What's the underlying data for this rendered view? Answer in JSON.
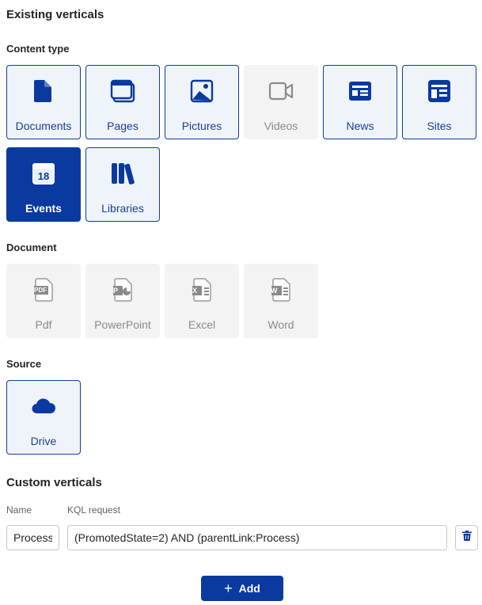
{
  "existing": {
    "title": "Existing verticals",
    "content_type": {
      "heading": "Content type",
      "tiles": [
        {
          "label": "Documents",
          "icon": "document-icon",
          "state": "active"
        },
        {
          "label": "Pages",
          "icon": "pages-icon",
          "state": "active"
        },
        {
          "label": "Pictures",
          "icon": "picture-icon",
          "state": "active"
        },
        {
          "label": "Videos",
          "icon": "video-icon",
          "state": "disabled"
        },
        {
          "label": "News",
          "icon": "news-icon",
          "state": "active"
        },
        {
          "label": "Sites",
          "icon": "sites-icon",
          "state": "active"
        },
        {
          "label": "Events",
          "icon": "calendar-icon",
          "state": "selected",
          "badge": "18"
        },
        {
          "label": "Libraries",
          "icon": "libraries-icon",
          "state": "active"
        }
      ]
    },
    "document": {
      "heading": "Document",
      "tiles": [
        {
          "label": "Pdf",
          "icon": "pdf-file-icon",
          "state": "disabled",
          "badge": "PDF"
        },
        {
          "label": "PowerPoint",
          "icon": "powerpoint-file-icon",
          "state": "disabled",
          "badge": "P"
        },
        {
          "label": "Excel",
          "icon": "excel-file-icon",
          "state": "disabled",
          "badge": "X"
        },
        {
          "label": "Word",
          "icon": "word-file-icon",
          "state": "disabled",
          "badge": "W"
        }
      ]
    },
    "source": {
      "heading": "Source",
      "tiles": [
        {
          "label": "Drive",
          "icon": "cloud-icon",
          "state": "active"
        }
      ]
    }
  },
  "custom": {
    "title": "Custom verticals",
    "name_col": "Name",
    "kql_col": "KQL request",
    "rows": [
      {
        "name": "Process",
        "kql": "(PromotedState=2) AND (parentLink:Process)"
      }
    ],
    "add_label": "Add"
  },
  "colors": {
    "accent": "#0a3aa0",
    "tile_active_bg": "#eff4fb",
    "tile_disabled_bg": "#f3f3f3"
  }
}
